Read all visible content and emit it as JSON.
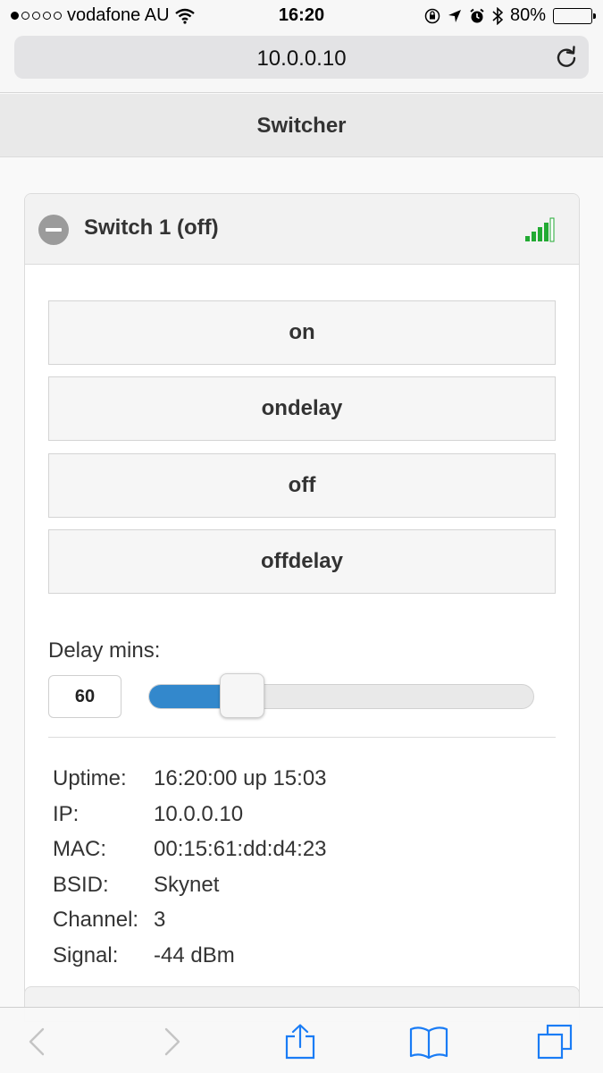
{
  "status_bar": {
    "carrier": "vodafone AU",
    "time": "16:20",
    "battery_percent": "80%",
    "battery_level": 0.8
  },
  "browser": {
    "url": "10.0.0.10"
  },
  "header": {
    "title": "Switcher"
  },
  "panel": {
    "title": "Switch 1 (off)",
    "buttons": [
      "on",
      "ondelay",
      "off",
      "offdelay"
    ],
    "delay_label": "Delay mins:",
    "delay_value": "60",
    "slider_fraction": 0.15,
    "info": [
      {
        "label": "Uptime:",
        "value": "16:20:00 up 15:03"
      },
      {
        "label": "IP:",
        "value": "10.0.0.10"
      },
      {
        "label": "MAC:",
        "value": "00:15:61:dd:d4:23"
      },
      {
        "label": "BSID:",
        "value": "Skynet"
      },
      {
        "label": "Channel:",
        "value": "3"
      },
      {
        "label": "Signal:",
        "value": "-44 dBm"
      }
    ]
  },
  "colors": {
    "accent": "#3388cc",
    "signal": "#22aa33",
    "ios_blue": "#1a7cf5"
  },
  "icons": [
    "minus-icon",
    "signal-strength-icon",
    "reload-icon",
    "wifi-icon",
    "back-icon",
    "forward-icon",
    "share-icon",
    "bookmarks-icon",
    "tabs-icon"
  ]
}
